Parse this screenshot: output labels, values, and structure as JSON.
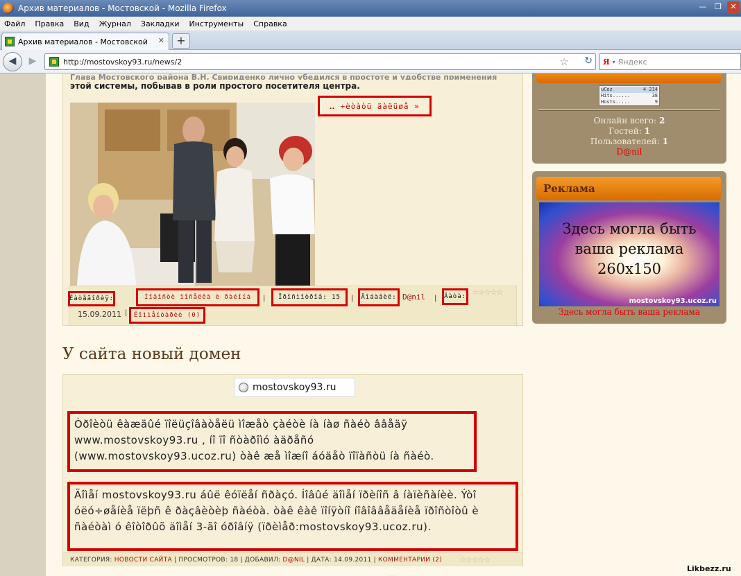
{
  "window": {
    "title": "Архив материалов - Мостовской - Mozilla Firefox"
  },
  "menu": [
    "Файл",
    "Правка",
    "Вид",
    "Журнал",
    "Закладки",
    "Инструменты",
    "Справка"
  ],
  "tab": {
    "title": "Архив материалов - Мостовской",
    "new_tab": "+"
  },
  "nav": {
    "url": "http://mostovskoy93.ru/news/2",
    "search_placeholder": "Яндекс",
    "search_engine": "Я"
  },
  "post1": {
    "intro_clipped": "Глава Мостовского района В.Н. Свириденко лично убедился в простоте и удобстве применения",
    "intro_line": "этой системы, побывав в роли простого посетителя центра.",
    "read_more": "… ÷èòàòü äàëüøå »",
    "meta": {
      "category_label": "Êàòåãîðèÿ:",
      "category_value": "Íîâîñòè ïîñåëêà è ðàéîíà",
      "views": "Ïðîñìîòðîâ: 15",
      "added_label": "Äîáàâèë:",
      "added_user": "D@nil",
      "date_label": "Äàòà:",
      "date": "15.09.2011",
      "comments": "Êîììåíòàðèè (0)"
    },
    "rating": "☆☆☆☆☆"
  },
  "post2": {
    "title": "У сайта новый домен",
    "url_chip": "mostovskoy93.ru",
    "para1": "Òðîèòü êàæäûé ïîëüçîâàòåëü ìîæåò çàéòè íà íàø ñàéò ââåäÿ  www.mostovskoy93.ru , íî ïî ñòàðîìó àäðåñó (www.mostovskoy93.ucoz.ru) òàê æå ìîæíî áóäåò ïîïàñòü íà ñàéò.",
    "para2": "Äîìåí mostovskoy93.ru áûë êóïëåí ñðàçó. Íîâûé äîìåí ïðèíîñ â íàïèñàíèè. Ýòî óëó÷øåíèå ïëþñ ê ðàçâèòèþ ñàéòà. òàê êàê ïîíÿòíî íîâîââåäåíèå ïðîñòîòû è ñàéòàì ó êîòîðûõ äîìåí 3-ãî óðîâíÿ (ïðèìåð:mostovskoy93.ucoz.ru).",
    "meta": {
      "category_label": "Категория:",
      "category_value": "Новости сайта",
      "views": "Просмотров: 18",
      "added_label": "Добавил:",
      "added_user": "D@nil",
      "date": "Дата: 14.09.2011",
      "comments": "Комментарии (2)"
    },
    "rating": "☆☆☆☆☆"
  },
  "sidebar": {
    "counter": [
      {
        "label": "uCoz",
        "value": "4 214"
      },
      {
        "label": "Hits......",
        "value": "38"
      },
      {
        "label": "Hosts.....",
        "value": "9"
      }
    ],
    "online_label": "Онлайн всего:",
    "online_value": "2",
    "guests_label": "Гостей:",
    "guests_value": "1",
    "users_label": "Пользователей:",
    "users_value": "1",
    "user_name": "D@nil",
    "ad_title": "Реклама",
    "ad_banner_line1": "Здесь могла быть",
    "ad_banner_line2": "ваша реклама",
    "ad_banner_line3": "260x150",
    "ad_banner_url": "mostovskoy93.ucoz.ru",
    "ad_link": "Здесь могла быть ваша реклама"
  },
  "watermark": "Likbezz.ru",
  "colors": {
    "accent_orange": "#e67a0a",
    "highlight_red": "#d40000",
    "sidebar_brown": "#9f8d6e"
  }
}
